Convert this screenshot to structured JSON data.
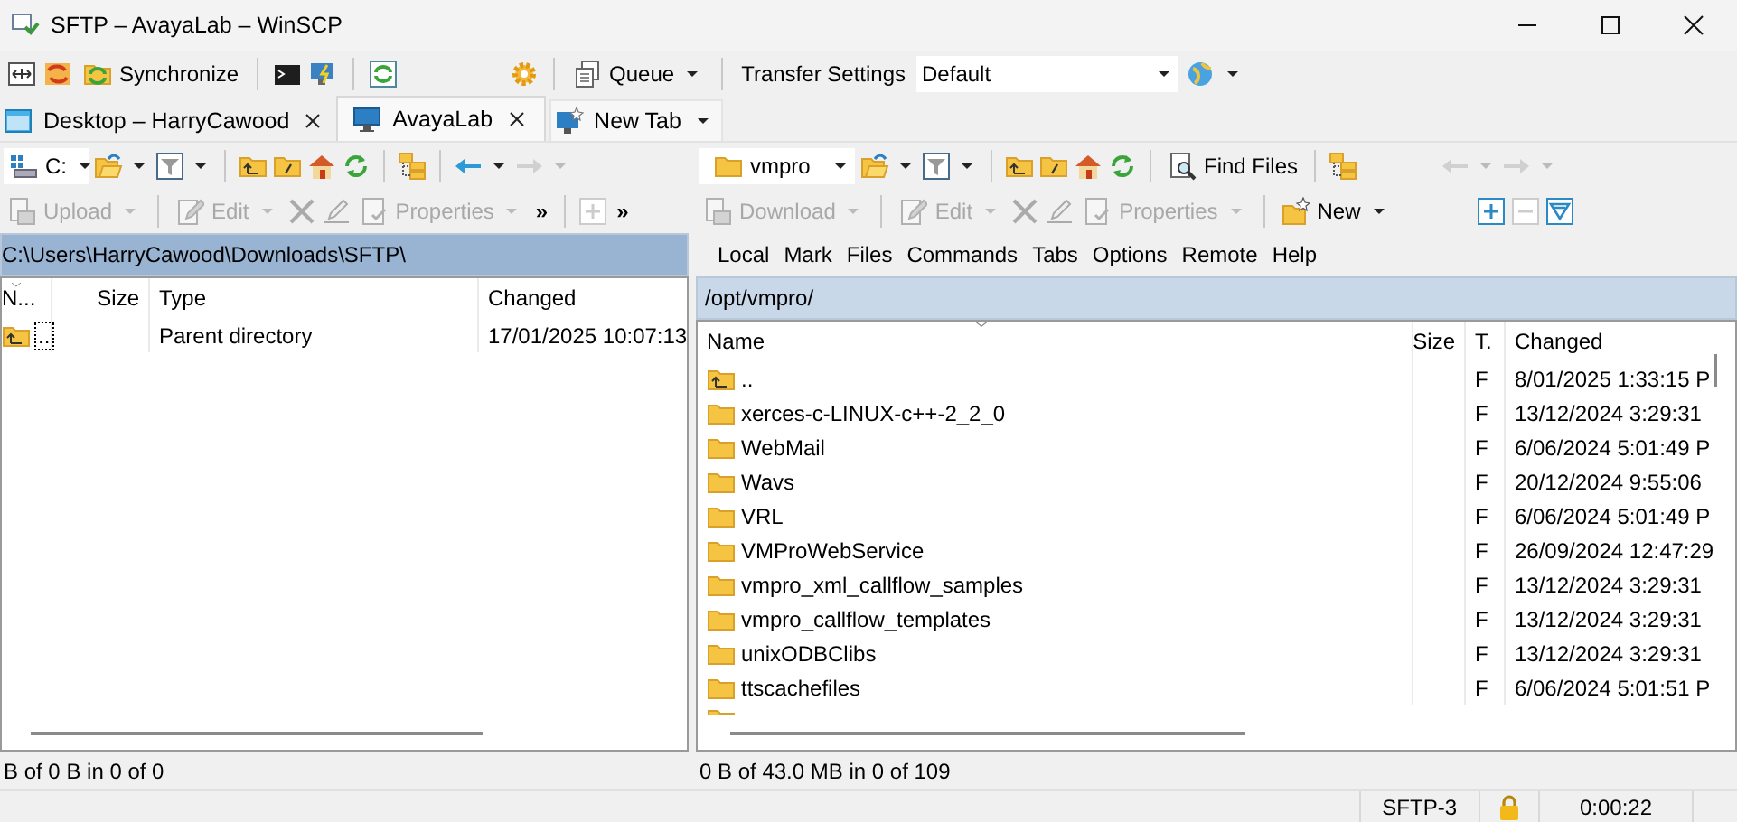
{
  "window": {
    "title": "SFTP – AvayaLab – WinSCP"
  },
  "toolbar": {
    "synchronize": "Synchronize",
    "queue": "Queue",
    "transfer_settings": "Transfer Settings",
    "preset": "Default"
  },
  "tabs": [
    {
      "label": "Desktop – HarryCawood",
      "kind": "local",
      "selected": false
    },
    {
      "label": "AvayaLab",
      "kind": "remote",
      "selected": true
    },
    {
      "label": "New Tab",
      "kind": "new",
      "selected": false
    }
  ],
  "left_panel": {
    "drive": "C:",
    "overflow_marks": [
      "»",
      "»"
    ],
    "commands": [
      {
        "kind": "upload",
        "label": "Upload",
        "disabled": true,
        "dropdown": true
      },
      {
        "kind": "edit",
        "label": "Edit",
        "disabled": true,
        "dropdown": true
      },
      {
        "kind": "delete",
        "disabled": true
      },
      {
        "kind": "rename",
        "disabled": true
      },
      {
        "kind": "properties",
        "label": "Properties",
        "disabled": true,
        "dropdown": true
      }
    ],
    "path": "C:\\Users\\HarryCawood\\Downloads\\SFTP\\",
    "columns": [
      "N...",
      "Size",
      "Type",
      "Changed"
    ],
    "rows": [
      {
        "kind": "parent",
        "name": "..",
        "type": "Parent directory",
        "changed": "17/01/2025 10:07:13",
        "focused": true
      }
    ],
    "summary": "B of 0 B in 0 of 0"
  },
  "right_panel": {
    "location": "vmpro",
    "find_files": "Find Files",
    "commands": [
      {
        "kind": "download",
        "label": "Download",
        "disabled": true,
        "dropdown": true
      },
      {
        "kind": "edit",
        "label": "Edit",
        "disabled": true,
        "dropdown": true
      },
      {
        "kind": "delete",
        "disabled": true
      },
      {
        "kind": "rename",
        "disabled": true
      },
      {
        "kind": "properties",
        "label": "Properties",
        "disabled": true,
        "dropdown": true
      },
      {
        "kind": "new",
        "label": "New",
        "disabled": false,
        "dropdown": true
      }
    ],
    "menu": [
      "Local",
      "Mark",
      "Files",
      "Commands",
      "Tabs",
      "Options",
      "Remote",
      "Help"
    ],
    "path": "/opt/vmpro/",
    "columns": [
      "Name",
      "Size",
      "T.",
      "Changed"
    ],
    "rows": [
      {
        "kind": "parent",
        "name": "..",
        "type": "F",
        "changed": "8/01/2025 1:33:15 P"
      },
      {
        "kind": "folder",
        "name": "xerces-c-LINUX-c++-2_2_0",
        "type": "F",
        "changed": "13/12/2024 3:29:31"
      },
      {
        "kind": "folder",
        "name": "WebMail",
        "type": "F",
        "changed": "6/06/2024 5:01:49 P"
      },
      {
        "kind": "folder",
        "name": "Wavs",
        "type": "F",
        "changed": "20/12/2024 9:55:06"
      },
      {
        "kind": "folder",
        "name": "VRL",
        "type": "F",
        "changed": "6/06/2024 5:01:49 P"
      },
      {
        "kind": "folder",
        "name": "VMProWebService",
        "type": "F",
        "changed": "26/09/2024 12:47:29"
      },
      {
        "kind": "folder",
        "name": "vmpro_xml_callflow_samples",
        "type": "F",
        "changed": "13/12/2024 3:29:31"
      },
      {
        "kind": "folder",
        "name": "vmpro_callflow_templates",
        "type": "F",
        "changed": "13/12/2024 3:29:31"
      },
      {
        "kind": "folder",
        "name": "unixODBClibs",
        "type": "F",
        "changed": "13/12/2024 3:29:31"
      },
      {
        "kind": "folder",
        "name": "ttscachefiles",
        "type": "F",
        "changed": "6/06/2024 5:01:51 P"
      }
    ],
    "summary": "0 B of 43.0 MB in 0 of 109"
  },
  "status_bar": {
    "protocol": "SFTP-3",
    "elapsed": "0:00:22"
  }
}
